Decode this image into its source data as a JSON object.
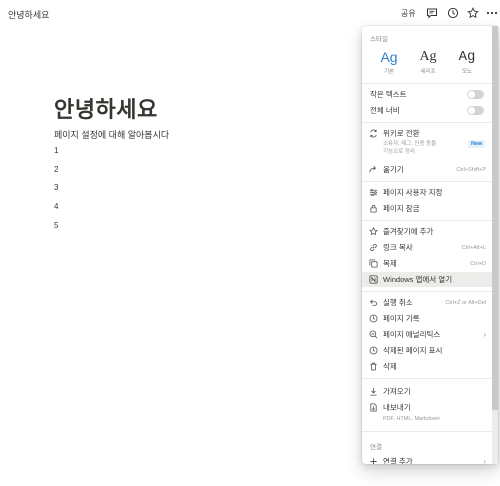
{
  "topbar": {
    "breadcrumb": "안녕하세요",
    "share_label": "공유",
    "icons": [
      "comment-icon",
      "history-icon",
      "star-icon",
      "more-icon"
    ]
  },
  "page": {
    "title": "안녕하세요",
    "subtitle": "페이지 설정에 대해 알아봅시다",
    "list": [
      "1",
      "2",
      "3",
      "4",
      "5"
    ]
  },
  "menu": {
    "style_header": "스타일",
    "fonts": [
      {
        "glyph": "Ag",
        "label": "기본"
      },
      {
        "glyph": "Ag",
        "label": "세리프"
      },
      {
        "glyph": "Ag",
        "label": "모노"
      }
    ],
    "small_text": "작은 텍스트",
    "full_width": "전체 너비",
    "wiki": {
      "label": "위키로 전환",
      "desc1": "소유자, 태그, 인증 등을",
      "desc2": "기능으로 정리",
      "badge": "New"
    },
    "move": {
      "label": "옮기기",
      "shortcut": "Ctrl+Shift+P"
    },
    "customize_page": "페이지 사용자 지정",
    "lock_page": "페이지 잠금",
    "add_favorite": "즐겨찾기에 추가",
    "copy_link": {
      "label": "링크 복사",
      "shortcut": "Ctrl+Alt+L"
    },
    "duplicate": {
      "label": "복제",
      "shortcut": "Ctrl+D"
    },
    "open_windows": "Windows 앱에서 열기",
    "undo": {
      "label": "실행 취소",
      "shortcut": "Ctrl+Z or Alt+Del"
    },
    "page_history": "페이지 기록",
    "page_analytics": "페이지 애널리틱스",
    "show_deleted": "삭제된 페이지 표시",
    "delete": "삭제",
    "import": "가져오기",
    "export": {
      "label": "내보내기",
      "desc": "PDF, HTML, Markdown"
    },
    "connections_header": "연결",
    "add_connection": "연결 추가"
  },
  "colors": {
    "accent": "#2d7fd0",
    "text": "#37352f",
    "muted": "#9b9a97",
    "highlight": "#ececeb"
  }
}
